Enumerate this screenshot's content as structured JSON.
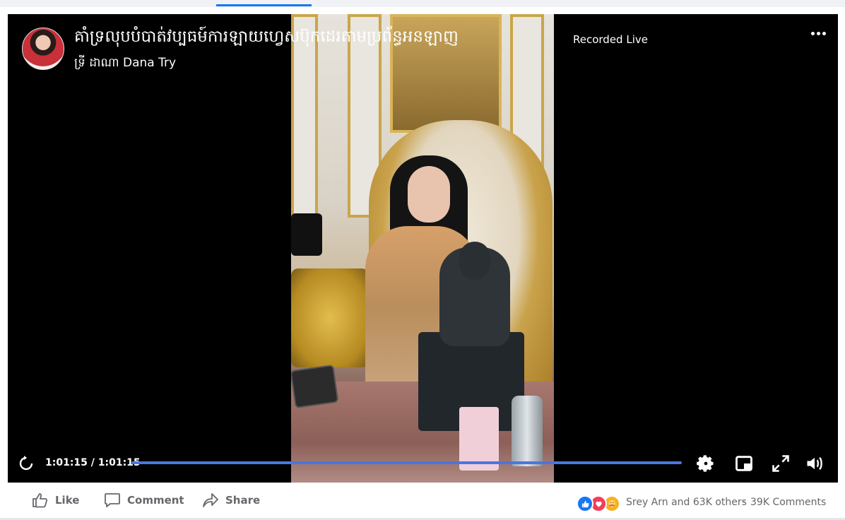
{
  "post": {
    "title": "គាំទ្រលុបបំបាត់វប្បធម៍ការឡាយហ្វេសប៊ុកដេរតាមប្រព័ន្ធអនឡាញ",
    "badge": "Recorded Live",
    "author": "ទ្រី ដាណា Dana Try"
  },
  "player": {
    "timecode": "1:01:15 / 1:01:15",
    "progress_fraction": 1.0,
    "icons": [
      "replay-icon",
      "settings-icon",
      "mini-player-icon",
      "fullscreen-icon",
      "volume-icon"
    ]
  },
  "actions": {
    "like": "Like",
    "comment": "Comment",
    "share": "Share"
  },
  "engagement": {
    "reactions_text": "Srey Arn and 63K others",
    "separator": "·",
    "comments_text": "39K Comments",
    "reaction_types": [
      "like",
      "love",
      "care"
    ]
  },
  "colors": {
    "accent": "#1877f2",
    "progress": "#4a76e0",
    "love": "#f33e58",
    "care": "#f7b125"
  }
}
